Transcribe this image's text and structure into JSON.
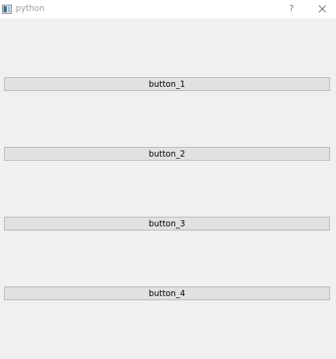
{
  "window": {
    "title": "python",
    "help_label": "?"
  },
  "buttons": [
    {
      "label": "button_1"
    },
    {
      "label": "button_2"
    },
    {
      "label": "button_3"
    },
    {
      "label": "button_4"
    }
  ]
}
